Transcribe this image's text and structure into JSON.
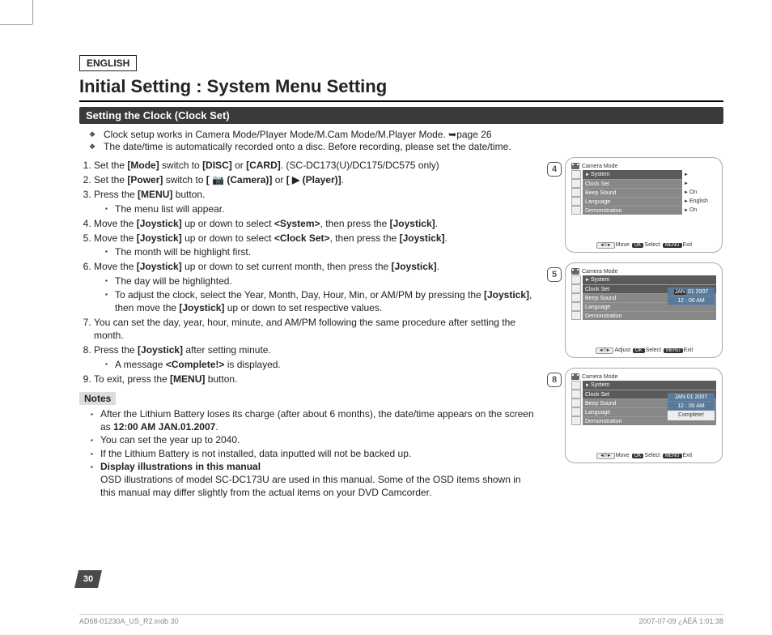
{
  "lang": "ENGLISH",
  "title": "Initial Setting : System Menu Setting",
  "section": "Setting the Clock (Clock Set)",
  "intro": [
    "Clock setup works in Camera Mode/Player Mode/M.Cam Mode/M.Player Mode. ➥page 26",
    "The date/time is automatically recorded onto a disc. Before recording, please set the date/time."
  ],
  "steps": {
    "s1a": "Set the ",
    "s1b": "[Mode]",
    "s1c": " switch to ",
    "s1d": "[DISC]",
    "s1e": " or ",
    "s1f": "[CARD]",
    "s1g": ". (SC-DC173(U)/DC175/DC575 only)",
    "s2a": "Set the ",
    "s2b": "[Power]",
    "s2c": " switch to ",
    "s2d": "[ 📷 (Camera)]",
    "s2e": " or ",
    "s2f": "[ ▶ (Player)]",
    "s2g": ".",
    "s3a": "Press the ",
    "s3b": "[MENU]",
    "s3c": " button.",
    "s3sub": "The menu list will appear.",
    "s4a": "Move the ",
    "s4b": "[Joystick]",
    "s4c": " up or down to select ",
    "s4d": "<System>",
    "s4e": ", then press the ",
    "s4f": "[Joystick]",
    "s4g": ".",
    "s5a": "Move the ",
    "s5b": "[Joystick]",
    "s5c": " up or down to select ",
    "s5d": "<Clock Set>",
    "s5e": ", then press the ",
    "s5f": "[Joystick]",
    "s5g": ".",
    "s5sub": "The month will be highlight first.",
    "s6a": "Move the ",
    "s6b": "[Joystick]",
    "s6c": " up or down to set current month, then press the ",
    "s6d": "[Joystick]",
    "s6e": ".",
    "s6sub1": "The day will be highlighted.",
    "s6sub2a": "To adjust the clock, select the Year, Month, Day, Hour, Min, or AM/PM by pressing the ",
    "s6sub2b": "[Joystick]",
    "s6sub2c": ", then move the ",
    "s6sub2d": "[Joystick]",
    "s6sub2e": " up or down to set respective values.",
    "s7": "You can set the day, year, hour, minute, and AM/PM following the same procedure after setting the month.",
    "s8a": "Press the ",
    "s8b": "[Joystick]",
    "s8c": " after setting minute.",
    "s8sub1": "A message ",
    "s8sub2": "<Complete!>",
    "s8sub3": " is displayed.",
    "s9a": "To exit, press the ",
    "s9b": "[MENU]",
    "s9c": " button."
  },
  "notesLabel": "Notes",
  "notes": {
    "n1a": "After the Lithium Battery loses its charge (after about 6 months), the date/time appears on the screen as ",
    "n1b": "12:00 AM JAN.01.2007",
    "n1c": ".",
    "n2": "You can set the year up to 2040.",
    "n3": "If the Lithium Battery is not installed, data inputted will not be backed up.",
    "n4a": "Display illustrations in this manual",
    "n4b": "OSD illustrations of model SC-DC173U are used in this manual. Some of the OSD items shown in this manual may differ slightly from the actual items on your DVD Camcorder."
  },
  "screens": {
    "mode": "Camera Mode",
    "sys": "System",
    "items": [
      "Clock Set",
      "Beep Sound",
      "Language",
      "Demonstration"
    ],
    "vals": [
      "On",
      "English",
      "On"
    ],
    "date1": "01  2007",
    "jan": "JAN",
    "date2": "12 : 00   AM",
    "dateFull": "JAN  01  2007",
    "complete": "Complete!",
    "move": "Move",
    "adjust": "Adjust",
    "select": "Select",
    "exit": "Exit",
    "ok": "OK",
    "menu": "MENU",
    "arrows": "◄◊►"
  },
  "badges": {
    "b4": "4",
    "b5": "5",
    "b8": "8"
  },
  "pageNum": "30",
  "footer": {
    "left": "AD68-01230A_US_R2.indb   30",
    "right": "2007-07-09   ¿ÀÈÄ 1:01:38"
  }
}
